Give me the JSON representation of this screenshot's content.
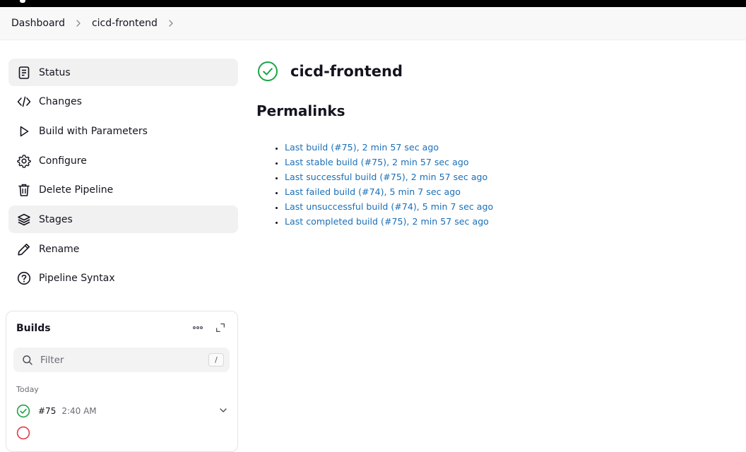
{
  "breadcrumb": {
    "items": [
      {
        "label": "Dashboard"
      },
      {
        "label": "cicd-frontend"
      }
    ]
  },
  "sidebar": {
    "items": [
      {
        "label": "Status",
        "icon": "document-icon",
        "active": true
      },
      {
        "label": "Changes",
        "icon": "code-icon",
        "active": false
      },
      {
        "label": "Build with Parameters",
        "icon": "play-icon",
        "active": false
      },
      {
        "label": "Configure",
        "icon": "gear-icon",
        "active": false
      },
      {
        "label": "Delete Pipeline",
        "icon": "trash-icon",
        "active": false
      },
      {
        "label": "Stages",
        "icon": "layers-icon",
        "active": true
      },
      {
        "label": "Rename",
        "icon": "pencil-icon",
        "active": false
      },
      {
        "label": "Pipeline Syntax",
        "icon": "help-circle-icon",
        "active": false
      }
    ]
  },
  "builds": {
    "title": "Builds",
    "filter_placeholder": "Filter",
    "filter_shortcut": "/",
    "group_label": "Today",
    "rows": [
      {
        "number": "#75",
        "time": "2:40 AM",
        "status": "success"
      }
    ]
  },
  "main": {
    "title": "cicd-frontend",
    "status": "success",
    "permalinks_heading": "Permalinks",
    "permalinks": [
      "Last build (#75), 2 min 57 sec ago",
      "Last stable build (#75), 2 min 57 sec ago",
      "Last successful build (#75), 2 min 57 sec ago",
      "Last failed build (#74), 5 min 7 sec ago",
      "Last unsuccessful build (#74), 5 min 7 sec ago",
      "Last completed build (#75), 2 min 57 sec ago"
    ]
  },
  "colors": {
    "success": "#1ea446",
    "failure": "#e5384b",
    "link": "#1a6fb8",
    "active_bg": "#f1f1f1"
  }
}
